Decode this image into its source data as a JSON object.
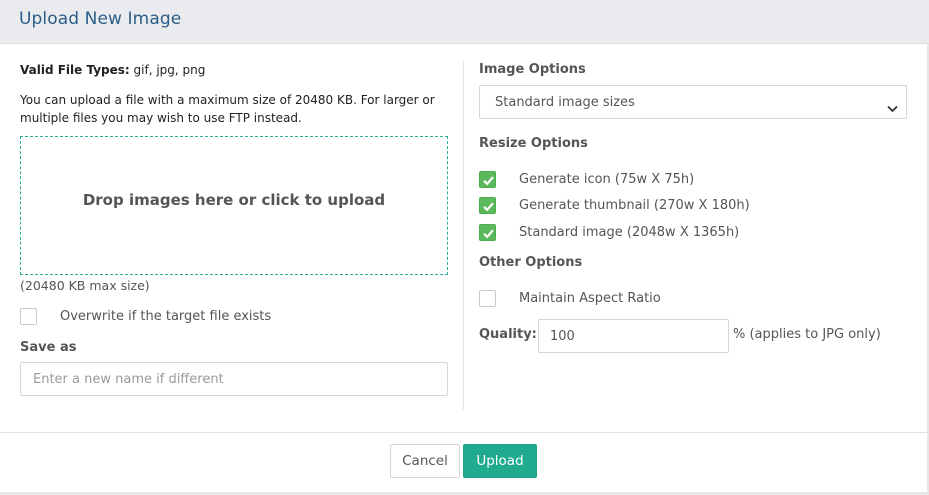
{
  "dialog": {
    "title": "Upload New Image"
  },
  "left": {
    "valid_types_label": "Valid File Types:",
    "valid_types_value": "gif, jpg, png",
    "max_size_info": "You can upload a file with a maximum size of 20480 KB. For larger or multiple files you may wish to use FTP instead.",
    "dropzone_text": "Drop images here or click to upload",
    "dropzone_max": "(20480 KB max size)",
    "overwrite_label": "Overwrite if the target file exists",
    "overwrite_checked": false,
    "save_as_label": "Save as",
    "save_as_placeholder": "Enter a new name if different",
    "save_as_value": ""
  },
  "right": {
    "image_options_label": "Image Options",
    "image_options_selected": "Standard image sizes",
    "resize_options_label": "Resize Options",
    "resize_options": [
      {
        "label": "Generate icon (75w X 75h)",
        "checked": true
      },
      {
        "label": "Generate thumbnail (270w X 180h)",
        "checked": true
      },
      {
        "label": "Standard image (2048w X 1365h)",
        "checked": true
      }
    ],
    "other_options_label": "Other Options",
    "maintain_aspect_label": "Maintain Aspect Ratio",
    "maintain_aspect_checked": false,
    "quality_label": "Quality:",
    "quality_value": "100",
    "quality_suffix": "% (applies to JPG only)"
  },
  "footer": {
    "cancel_label": "Cancel",
    "upload_label": "Upload"
  },
  "colors": {
    "header_bg": "#e9ebee",
    "title_text": "#2d5c88",
    "accent_teal": "#20ab8f",
    "checkbox_green": "#5cb85c",
    "dropzone_border": "#2bab98"
  },
  "icons": {
    "checkbox_checked": "check-icon",
    "select_arrow": "chevron-down-icon"
  }
}
